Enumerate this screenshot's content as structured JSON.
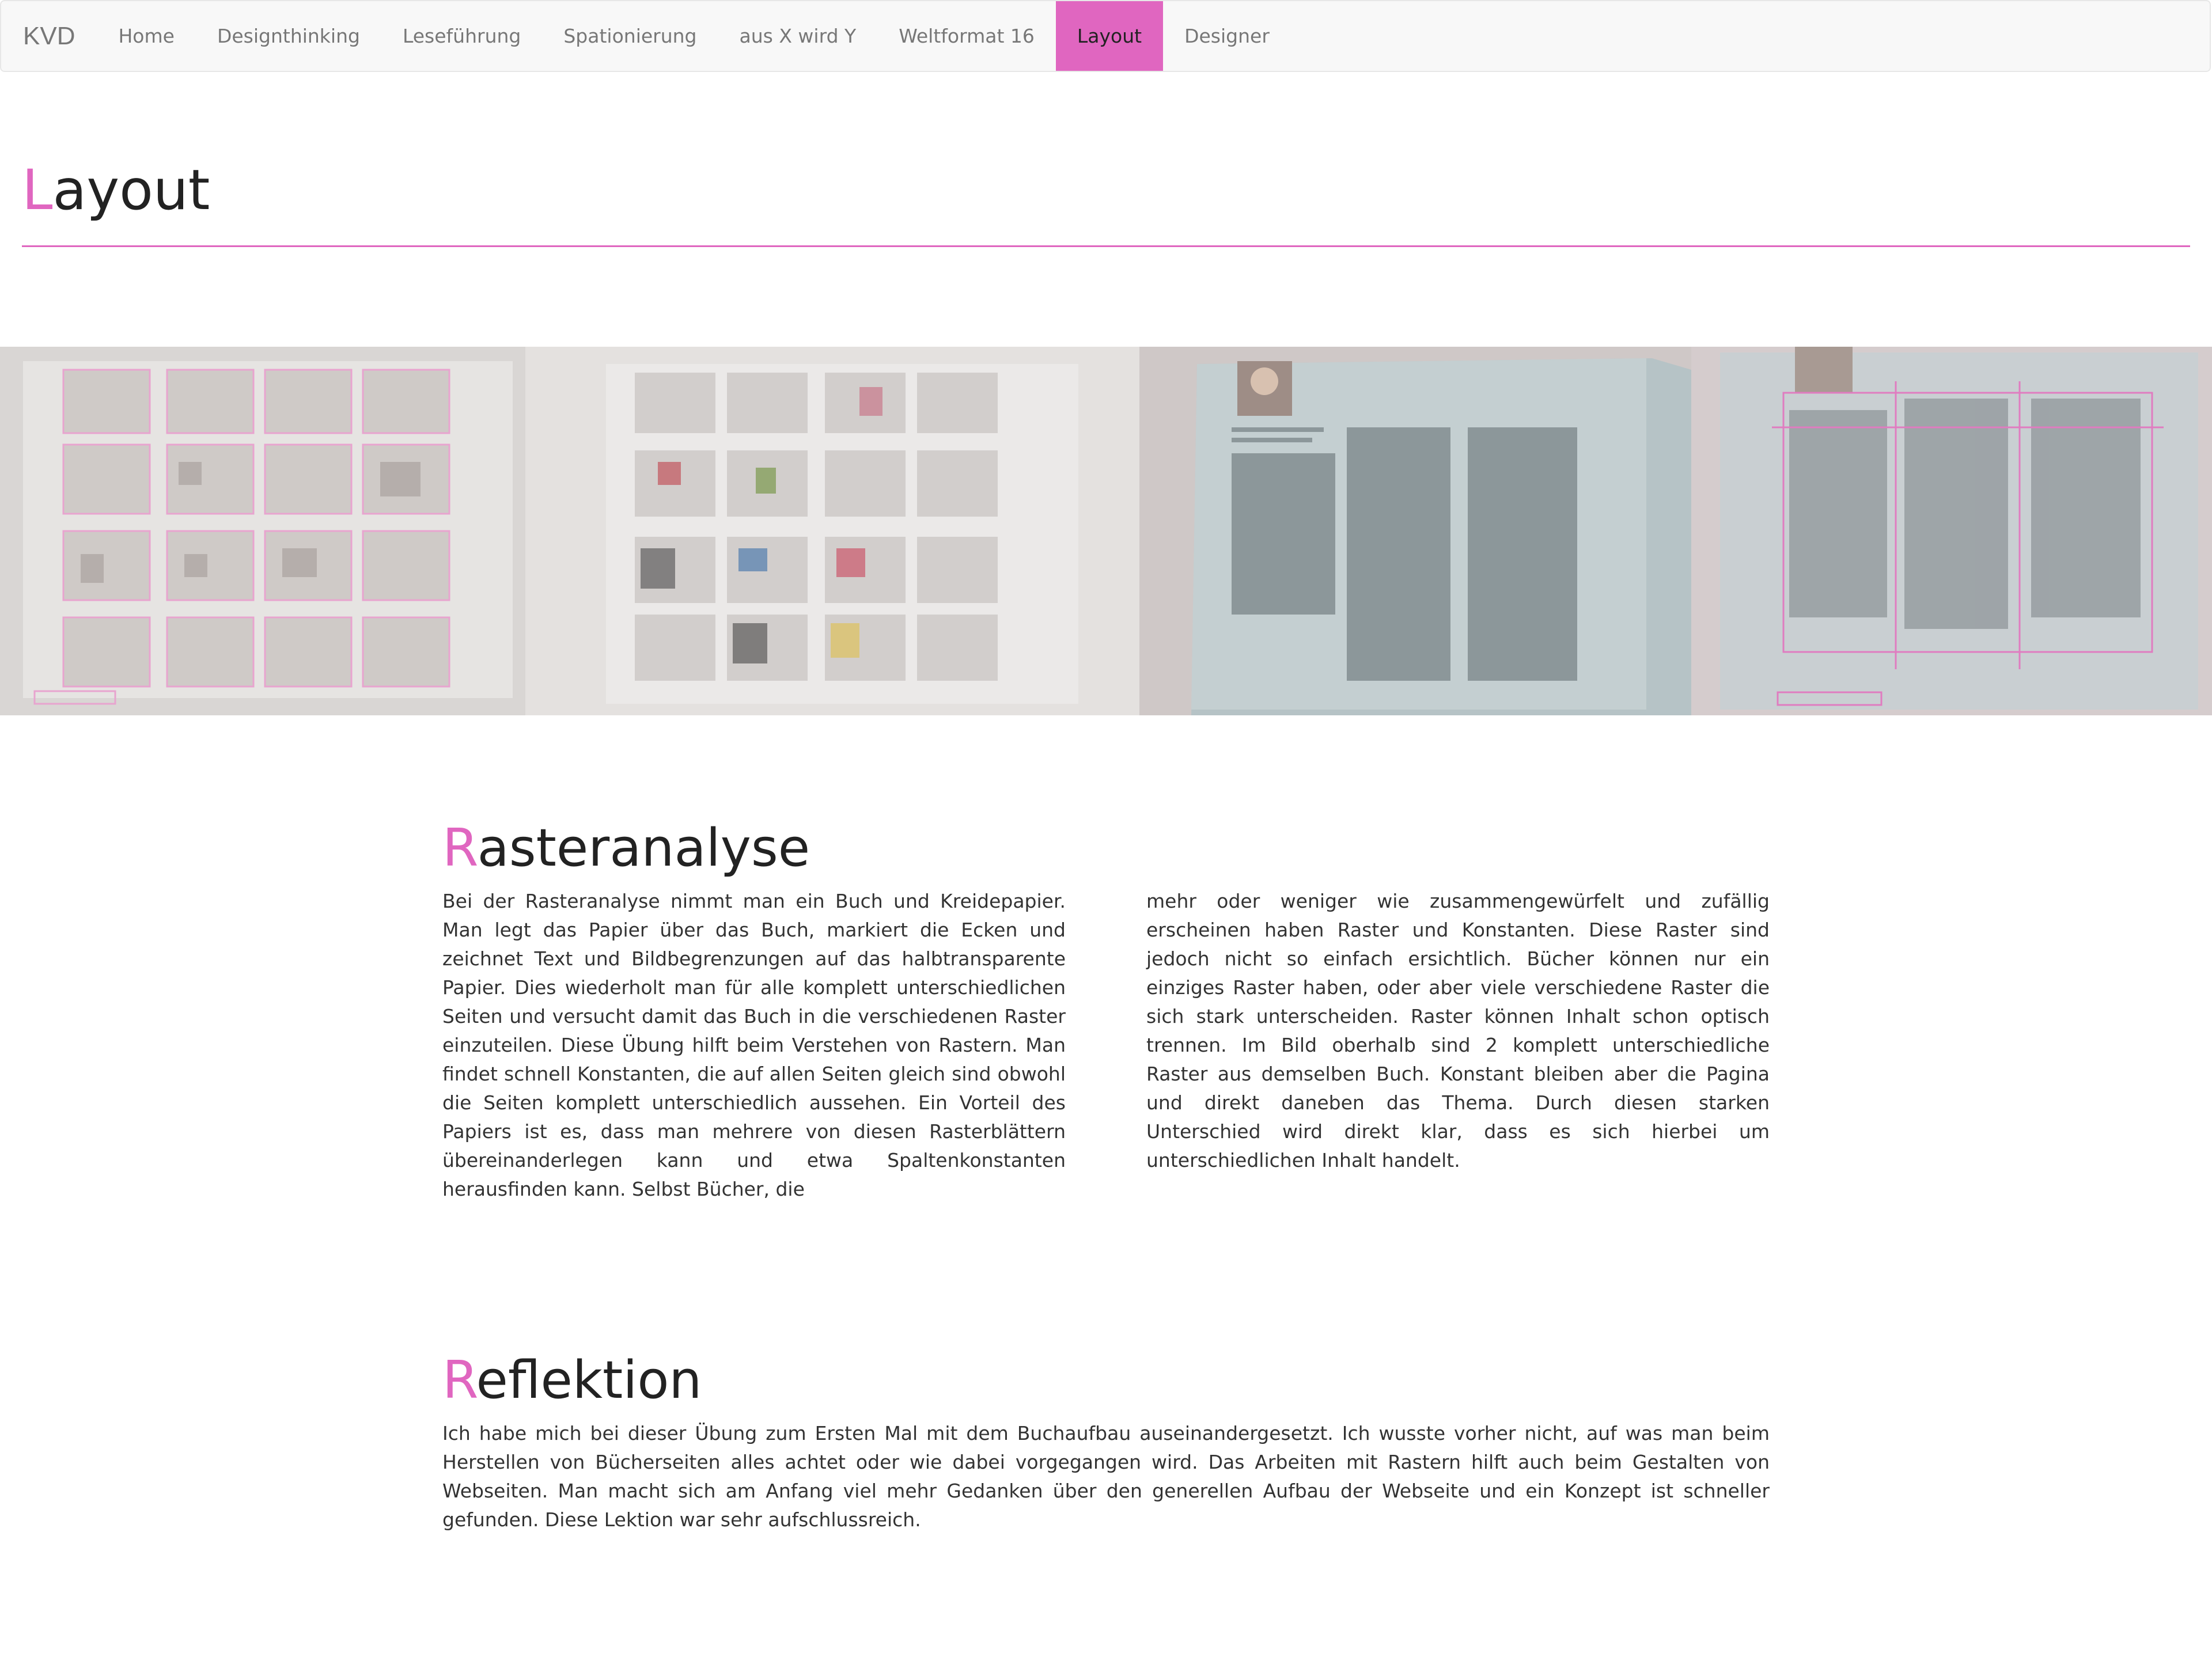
{
  "nav": {
    "brand": "KVD",
    "items": [
      {
        "label": "Home"
      },
      {
        "label": "Designthinking"
      },
      {
        "label": "Leseführung"
      },
      {
        "label": "Spationierung"
      },
      {
        "label": "aus X wird Y"
      },
      {
        "label": "Weltformat 16"
      },
      {
        "label": "Layout",
        "active": true
      },
      {
        "label": "Designer"
      }
    ]
  },
  "colors": {
    "accent": "#e066c0",
    "nav_bg": "#f8f8f8",
    "text": "#333333"
  },
  "page": {
    "title_initial": "L",
    "title_rest": "ayout"
  },
  "rasteranalyse": {
    "title_initial": "R",
    "title_rest": "asteranalyse",
    "col1": "Bei der Rasteranalyse nimmt man ein Buch und Kreidepapier. Man legt das Papier über das Buch, markiert die Ecken und zeichnet Text und Bildbegrenzungen auf das halbtransparente Papier. Dies wiederholt man für alle komplett unterschiedlichen Seiten und versucht damit das Buch in die verschiedenen Raster einzuteilen. Diese Übung hilft beim Verstehen von Rastern. Man findet schnell Konstanten, die auf allen Seiten gleich sind obwohl die Seiten komplett unterschiedlich aussehen. Ein Vorteil des Papiers ist es, dass man mehrere von diesen Rasterblättern übereinanderlegen kann und etwa Spaltenkonstanten herausfinden kann. Selbst Bücher, die",
    "col2": "mehr oder weniger wie zusammengewürfelt und zufällig erscheinen haben Raster und Konstanten. Diese Raster sind jedoch nicht so einfach ersichtlich. Bücher können nur ein einziges Raster haben, oder aber viele verschiedene Raster die sich stark unterscheiden. Raster können Inhalt schon optisch trennen. Im Bild oberhalb sind 2 komplett unterschiedliche Raster aus demselben Buch. Konstant bleiben aber die Pagina und direkt daneben das Thema. Durch diesen starken Unterschied wird direkt klar, dass es sich hierbei um unterschiedlichen Inhalt handelt."
  },
  "reflektion": {
    "title_initial": "R",
    "title_rest": "eflektion",
    "text": "Ich habe mich bei dieser Übung zum Ersten Mal mit dem Buchaufbau auseinandergesetzt. Ich wusste vorher nicht, auf was man beim Herstellen von Bücherseiten alles achtet oder wie dabei vorgegangen wird. Das Arbeiten mit Rastern hilft auch beim Gestalten von Webseiten. Man macht sich am Anfang viel mehr Gedanken über den generellen Aufbau der Webseite und ein Konzept ist schneller gefunden. Diese Lektion war sehr aufschlussreich."
  }
}
